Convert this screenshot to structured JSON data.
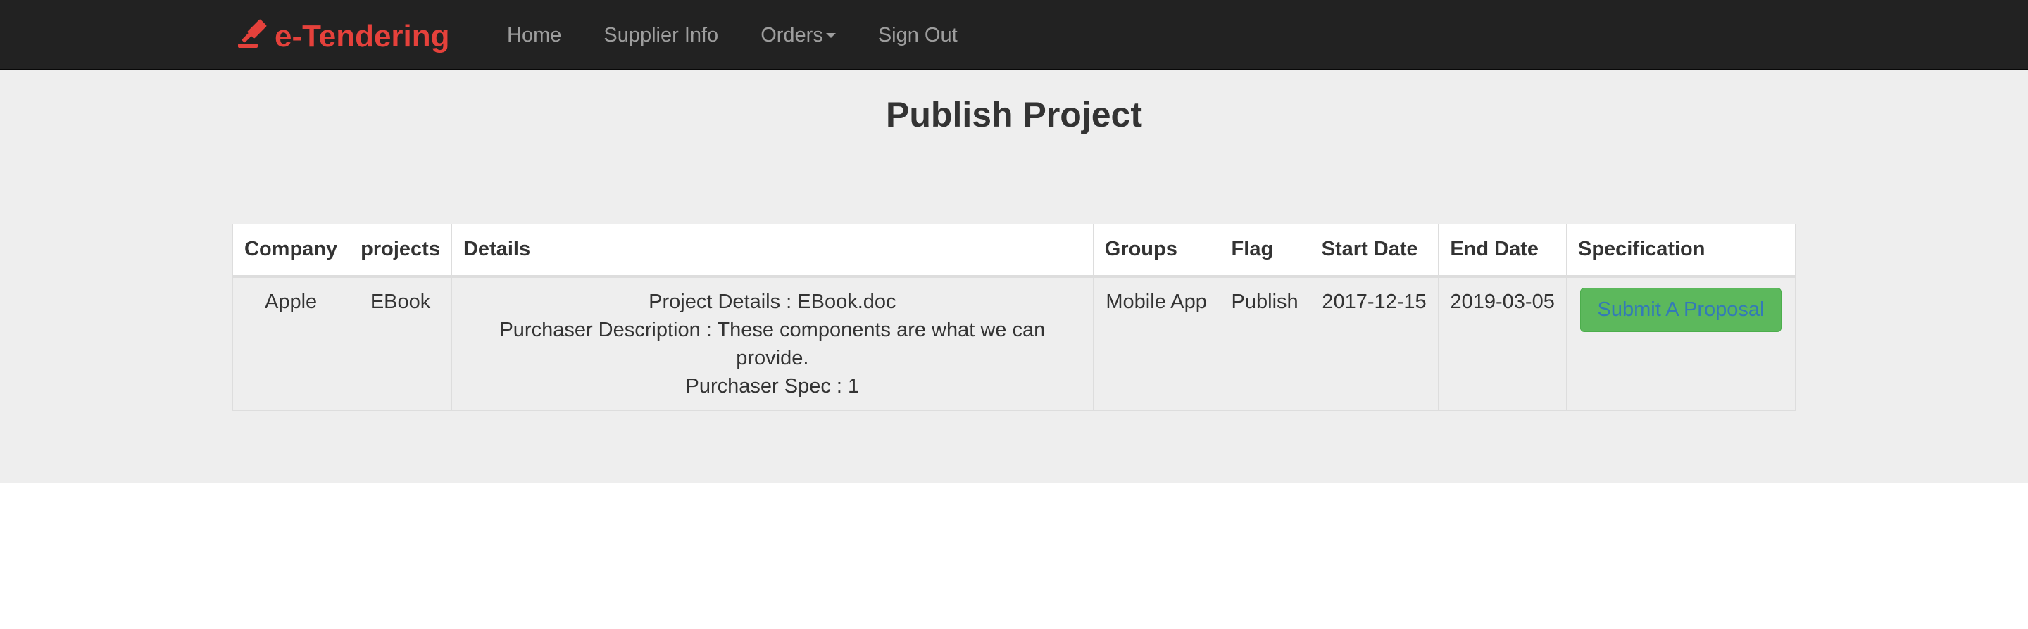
{
  "navbar": {
    "brand": "e-Tendering",
    "links": [
      {
        "label": "Home"
      },
      {
        "label": "Supplier Info"
      },
      {
        "label": "Orders"
      },
      {
        "label": "Sign Out"
      }
    ]
  },
  "colors": {
    "navbar_bg": "#222222",
    "brand": "#e5413b",
    "nav_link": "#9d9d9d",
    "jumbotron_bg": "#eeeeee",
    "button_bg": "#5cb85c",
    "button_text": "#337ab7"
  },
  "page": {
    "title": "Publish Project"
  },
  "table": {
    "headers": [
      "Company",
      "projects",
      "Details",
      "Groups",
      "Flag",
      "Start Date",
      "End Date",
      "Specification"
    ],
    "rows": [
      {
        "company": "Apple",
        "project": "EBook",
        "details": [
          "Project Details : EBook.doc",
          "Purchaser Description : These components are what we can provide.",
          "Purchaser Spec : 1"
        ],
        "group": "Mobile App",
        "flag": "Publish",
        "start_date": "2017-12-15",
        "end_date": "2019-03-05",
        "action": "Submit A Proposal"
      }
    ]
  }
}
